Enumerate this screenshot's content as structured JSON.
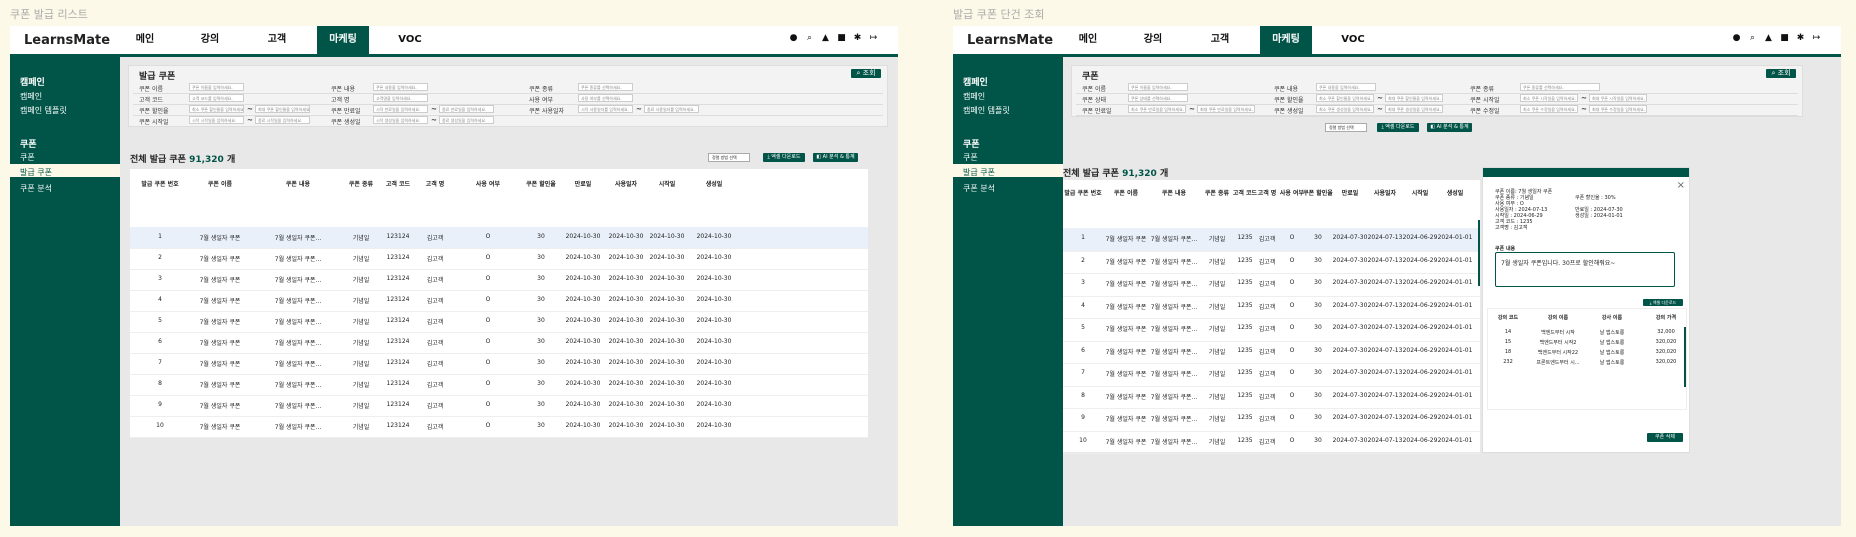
{
  "left_frame_title": "쿠폰 발급 리스트",
  "right_frame_title": "발급 쿠폰 단건 조회",
  "logo": "LearnsMate",
  "nav": [
    "메인",
    "강의",
    "고객",
    "마케팅",
    "VOC"
  ],
  "sidebar": {
    "section1": "캠페인",
    "section1_items": [
      "캠페인",
      "캠페인 템플릿"
    ],
    "section2": "쿠폰",
    "section2_items": [
      "쿠폰",
      "발급 쿠폰",
      "쿠폰 분석"
    ]
  },
  "filter": {
    "title": "발급 쿠폰",
    "search_label": "조회",
    "left": {
      "rows": [
        [
          {
            "label": "쿠폰 이름",
            "ph": "쿠폰 이름을 입력하세요."
          },
          {
            "label": "쿠폰 내용",
            "ph": "쿠폰 내용을 입력하세요."
          },
          {
            "label": "쿠폰 종류",
            "ph": "쿠폰 종류를 선택하세요."
          }
        ],
        [
          {
            "label": "고객 코드",
            "ph": "고객 코드를 입력하세요."
          },
          {
            "label": "고객 명",
            "ph": "고객명을 입력하세요."
          },
          {
            "label": "사용 여부",
            "ph": "사용 여부를 선택하세요."
          }
        ],
        [
          {
            "label": "쿠폰 할인율",
            "ph": "최소 쿠폰 할인율을 입력하세요.",
            "ph2": "최대 쿠폰 할인율을 입력하세요."
          },
          {
            "label": "쿠폰 만료일",
            "ph": "시작 만료일을 입력하세요.",
            "ph2": "종료 만료일을 입력하세요."
          },
          {
            "label": "쿠폰 사용일자",
            "ph": "시작 사용일자를 입력하세요.",
            "ph2": "종료 사용일자를 입력하세요."
          }
        ],
        [
          {
            "label": "쿠폰 시작일",
            "ph": "시작 시작일을 입력하세요.",
            "ph2": "종료 시작일을 입력하세요."
          },
          {
            "label": "쿠폰 생성일",
            "ph": "시작 생성일을 입력하세요.",
            "ph2": "종료 생성일을 입력하세요."
          }
        ]
      ]
    },
    "right": {
      "title": "쿠폰",
      "rows": [
        [
          {
            "label": "쿠폰 이름",
            "ph": "쿠폰 이름을 입력하세요."
          },
          {
            "label": "쿠폰 내용",
            "ph": "쿠폰 내용을 입력하세요."
          },
          {
            "label": "쿠폰 종류",
            "ph": "쿠폰 종류를 선택하세요."
          }
        ],
        [
          {
            "label": "쿠폰 상태",
            "ph": "쿠폰 상태를 선택하세요."
          },
          {
            "label": "쿠폰 할인율",
            "ph": "최소 쿠폰 할인율을 입력하세요.",
            "ph2": "최대 쿠폰 할인율을 입력하세요."
          },
          {
            "label": "쿠폰 시작일",
            "ph": "최소 쿠폰 시작일을 입력하세요.",
            "ph2": "최대 쿠폰 시작일을 입력하세요."
          }
        ],
        [
          {
            "label": "쿠폰 만료일",
            "ph": "최소 쿠폰 만료일을 입력하세요.",
            "ph2": "최대 쿠폰 만료일을 입력하세요."
          },
          {
            "label": "쿠폰 생성일",
            "ph": "최소 쿠폰 생성일을 입력하세요.",
            "ph2": "최대 쿠폰 생성일을 입력하세요."
          },
          {
            "label": "쿠폰 수정일",
            "ph": "최소 쿠폰 수정일을 입력하세요.",
            "ph2": "최대 쿠폰 수정일을 입력하세요."
          }
        ]
      ]
    }
  },
  "total_prefix": "전체 발급 쿠폰 ",
  "total_count": "91,320",
  "total_suffix": " 개",
  "sort_placeholder": "정렬 방법 선택",
  "excel_label": "엑셀 다운로드",
  "analysis_label": "AI 분석 & 통계",
  "left_table": {
    "headers": [
      "발급 쿠폰 번호",
      "쿠폰 이름",
      "쿠폰 내용",
      "쿠폰 종류",
      "고객 코드",
      "고객 명",
      "사용 여부",
      "쿠폰 할인율",
      "만료일",
      "사용일자",
      "시작일",
      "생성일"
    ],
    "rows": [
      [
        "1",
        "7월 생일자 쿠폰",
        "7월 생일자 쿠폰...",
        "기념일",
        "123124",
        "김고객",
        "O",
        "30",
        "2024-10-30",
        "2024-10-30",
        "2024-10-30",
        "2024-10-30"
      ],
      [
        "2",
        "7월 생일자 쿠폰",
        "7월 생일자 쿠폰...",
        "기념일",
        "123124",
        "김고객",
        "O",
        "30",
        "2024-10-30",
        "2024-10-30",
        "2024-10-30",
        "2024-10-30"
      ],
      [
        "3",
        "7월 생일자 쿠폰",
        "7월 생일자 쿠폰...",
        "기념일",
        "123124",
        "김고객",
        "O",
        "30",
        "2024-10-30",
        "2024-10-30",
        "2024-10-30",
        "2024-10-30"
      ],
      [
        "4",
        "7월 생일자 쿠폰",
        "7월 생일자 쿠폰...",
        "기념일",
        "123124",
        "김고객",
        "O",
        "30",
        "2024-10-30",
        "2024-10-30",
        "2024-10-30",
        "2024-10-30"
      ],
      [
        "5",
        "7월 생일자 쿠폰",
        "7월 생일자 쿠폰...",
        "기념일",
        "123124",
        "김고객",
        "O",
        "30",
        "2024-10-30",
        "2024-10-30",
        "2024-10-30",
        "2024-10-30"
      ],
      [
        "6",
        "7월 생일자 쿠폰",
        "7월 생일자 쿠폰...",
        "기념일",
        "123124",
        "김고객",
        "O",
        "30",
        "2024-10-30",
        "2024-10-30",
        "2024-10-30",
        "2024-10-30"
      ],
      [
        "7",
        "7월 생일자 쿠폰",
        "7월 생일자 쿠폰...",
        "기념일",
        "123124",
        "김고객",
        "O",
        "30",
        "2024-10-30",
        "2024-10-30",
        "2024-10-30",
        "2024-10-30"
      ],
      [
        "8",
        "7월 생일자 쿠폰",
        "7월 생일자 쿠폰...",
        "기념일",
        "123124",
        "김고객",
        "O",
        "30",
        "2024-10-30",
        "2024-10-30",
        "2024-10-30",
        "2024-10-30"
      ],
      [
        "9",
        "7월 생일자 쿠폰",
        "7월 생일자 쿠폰...",
        "기념일",
        "123124",
        "김고객",
        "O",
        "30",
        "2024-10-30",
        "2024-10-30",
        "2024-10-30",
        "2024-10-30"
      ],
      [
        "10",
        "7월 생일자 쿠폰",
        "7월 생일자 쿠폰...",
        "기념일",
        "123124",
        "김고객",
        "O",
        "30",
        "2024-10-30",
        "2024-10-30",
        "2024-10-30",
        "2024-10-30"
      ]
    ]
  },
  "right_table": {
    "headers": [
      "발급 쿠폰 번호",
      "쿠폰 이름",
      "쿠폰 내용",
      "쿠폰 종류",
      "고객 코드",
      "고객 명",
      "사용 여부",
      "쿠폰 할인율",
      "만료일",
      "사용일자",
      "시작일",
      "생성일"
    ],
    "rows": [
      [
        "1",
        "7월 생일자 쿠폰",
        "7월 생일자 쿠폰...",
        "기념일",
        "1235",
        "김고객",
        "O",
        "30",
        "2024-07-30",
        "2024-07-13",
        "2024-06-29",
        "2024-01-01"
      ],
      [
        "2",
        "7월 생일자 쿠폰",
        "7월 생일자 쿠폰...",
        "기념일",
        "1235",
        "김고객",
        "O",
        "30",
        "2024-07-30",
        "2024-07-13",
        "2024-06-29",
        "2024-01-01"
      ],
      [
        "3",
        "7월 생일자 쿠폰",
        "7월 생일자 쿠폰...",
        "기념일",
        "1235",
        "김고객",
        "O",
        "30",
        "2024-07-30",
        "2024-07-13",
        "2024-06-29",
        "2024-01-01"
      ],
      [
        "4",
        "7월 생일자 쿠폰",
        "7월 생일자 쿠폰...",
        "기념일",
        "1235",
        "김고객",
        "O",
        "30",
        "2024-07-30",
        "2024-07-13",
        "2024-06-29",
        "2024-01-01"
      ],
      [
        "5",
        "7월 생일자 쿠폰",
        "7월 생일자 쿠폰...",
        "기념일",
        "1235",
        "김고객",
        "O",
        "30",
        "2024-07-30",
        "2024-07-13",
        "2024-06-29",
        "2024-01-01"
      ],
      [
        "6",
        "7월 생일자 쿠폰",
        "7월 생일자 쿠폰...",
        "기념일",
        "1235",
        "김고객",
        "O",
        "30",
        "2024-07-30",
        "2024-07-13",
        "2024-06-29",
        "2024-01-01"
      ],
      [
        "7",
        "7월 생일자 쿠폰",
        "7월 생일자 쿠폰...",
        "기념일",
        "1235",
        "김고객",
        "O",
        "30",
        "2024-07-30",
        "2024-07-13",
        "2024-06-29",
        "2024-01-01"
      ],
      [
        "8",
        "7월 생일자 쿠폰",
        "7월 생일자 쿠폰...",
        "기념일",
        "1235",
        "김고객",
        "O",
        "30",
        "2024-07-30",
        "2024-07-13",
        "2024-06-29",
        "2024-01-01"
      ],
      [
        "9",
        "7월 생일자 쿠폰",
        "7월 생일자 쿠폰...",
        "기념일",
        "1235",
        "김고객",
        "O",
        "30",
        "2024-07-30",
        "2024-07-13",
        "2024-06-29",
        "2024-01-01"
      ],
      [
        "10",
        "7월 생일자 쿠폰",
        "7월 생일자 쿠폰...",
        "기념일",
        "1235",
        "김고객",
        "O",
        "30",
        "2024-07-30",
        "2024-07-13",
        "2024-06-29",
        "2024-01-01"
      ]
    ]
  },
  "detail": {
    "info": [
      [
        "쿠폰 이름: 7월 생일자 쿠폰",
        ""
      ],
      [
        "쿠폰 종류 : 기념일",
        "쿠폰 할인율 : 30%"
      ],
      [
        "사용 여부 : O",
        ""
      ],
      [
        "사용일자 : 2024-07-13",
        "만료일 : 2024-07-30"
      ],
      [
        "시작일 : 2024-06-29",
        "생성일 : 2024-01-01"
      ],
      [
        "고객 코드 : 1235",
        ""
      ],
      [
        "고객명 : 김고객",
        ""
      ]
    ],
    "memo_label": "쿠폰 내용",
    "memo": "7월 생일자 쿠폰입니다. 30프로 할인해줘요~",
    "excel_label": "엑셀 다운로드",
    "lecture_headers": [
      "강의 코드",
      "강의 이름",
      "강사 이름",
      "강의 가격"
    ],
    "lectures": [
      [
        "14",
        "백엔드부터 시작",
        "날 앱스토롱",
        "32,000"
      ],
      [
        "15",
        "백엔드부터 시작2",
        "날 앱스토롱",
        "320,020"
      ],
      [
        "18",
        "백엔드부터 시작22",
        "날 앱스토롱",
        "320,020"
      ],
      [
        "232",
        "프론트엔드부터 시...",
        "날 앱스토롱",
        "320,020"
      ]
    ],
    "delete_label": "쿠폰 삭제"
  },
  "colors": {
    "brand": "#005448",
    "background": "#fdf9e8"
  }
}
